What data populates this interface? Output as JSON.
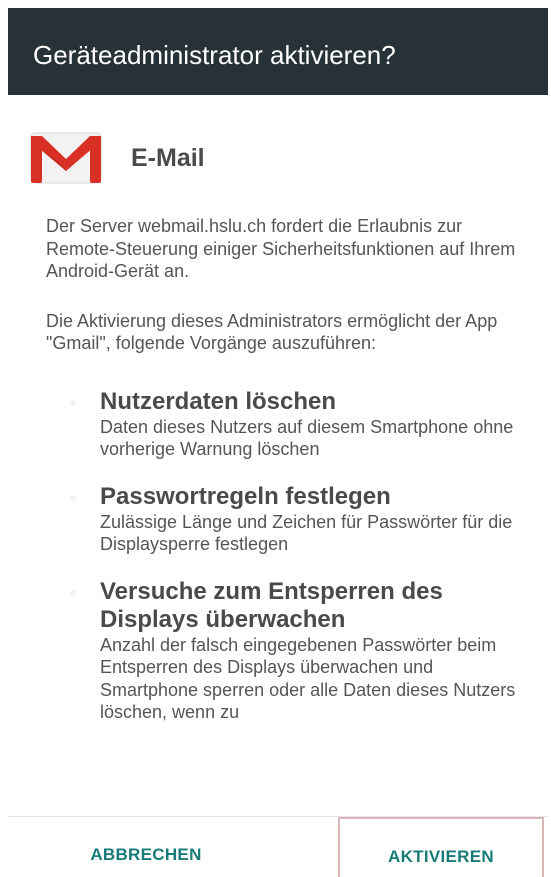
{
  "dialog": {
    "title": "Geräteadministrator aktivieren?",
    "app": {
      "icon": "gmail-icon",
      "name": "E-Mail"
    },
    "description": "Der Server webmail.hslu.ch fordert die Erlaubnis zur Remote-Steuerung einiger Sicherheitsfunktionen auf Ihrem Android-Gerät an.",
    "intro": "Die Aktivierung dieses Administrators ermöglicht der App \"Gmail\", folgende Vorgänge auszuführen:",
    "policies": [
      {
        "title": "Nutzerdaten löschen",
        "description": "Daten dieses Nutzers auf diesem Smartphone ohne vorherige Warnung löschen"
      },
      {
        "title": "Passwortregeln festlegen",
        "description": "Zulässige Länge und Zeichen für Passwörter für die Displaysperre festlegen"
      },
      {
        "title": "Versuche zum Entsperren des Displays überwachen",
        "description": "Anzahl der falsch eingegebenen Passwörter beim Entsperren des Displays überwachen und Smartphone sperren oder alle Daten dieses Nutzers löschen, wenn zu"
      }
    ]
  },
  "buttons": {
    "cancel": "ABBRECHEN",
    "activate": "AKTIVIEREN"
  },
  "colors": {
    "header_background": "#263238",
    "accent": "#177b78",
    "gmail_red": "#d93025"
  }
}
